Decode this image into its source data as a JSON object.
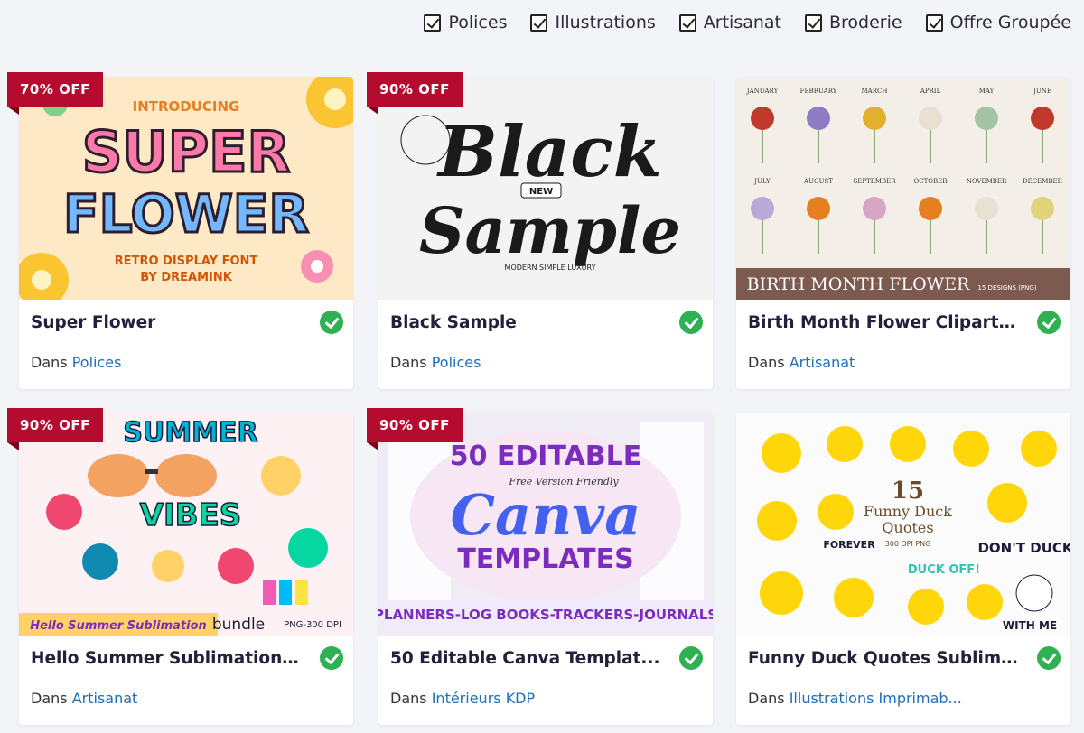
{
  "filters": [
    "Polices",
    "Illustrations",
    "Artisanat",
    "Broderie",
    "Offre Groupée"
  ],
  "category_prefix": "Dans",
  "cards": [
    {
      "badge": "70% OFF",
      "title": "Super Flower",
      "category": "Polices",
      "thumb": {
        "line1": "INTRODUCING",
        "big1": "SUPER",
        "big2": "FLOWER",
        "sub1": "RETRO DISPLAY FONT",
        "sub2": "BY DREAMINK"
      }
    },
    {
      "badge": "90% OFF",
      "title": "Black Sample",
      "category": "Polices",
      "thumb": {
        "big1": "Black",
        "big2": "Sample",
        "tag": "NEW",
        "sub": "MODERN SIMPLE LUXURY"
      }
    },
    {
      "badge": "",
      "title": "Birth Month Flower Clipart B...",
      "category": "Artisanat",
      "thumb": {
        "months_top": [
          "JANUARY",
          "FEBRUARY",
          "MARCH",
          "APRIL",
          "MAY",
          "JUNE"
        ],
        "months_bottom": [
          "JULY",
          "AUGUST",
          "SEPTEMBER",
          "OCTOBER",
          "NOVEMBER",
          "DECEMBER"
        ],
        "banner": "BIRTH MONTH FLOWER",
        "banner_sub": "15 DESIGNS (PNG)"
      }
    },
    {
      "badge": "90% OFF",
      "title": "Hello Summer Sublimation ...",
      "category": "Artisanat",
      "thumb": {
        "big": "SUMMER",
        "vibes": "VIBES",
        "footer": "Hello Summer Sublimation",
        "bundle": "bundle",
        "dpi": "PNG-300 DPI"
      }
    },
    {
      "badge": "90% OFF",
      "title": "50 Editable Canva Templat...",
      "category": "Intérieurs KDP",
      "thumb": {
        "line1": "50 EDITABLE",
        "script_small": "Free Version Friendly",
        "script": "Canva",
        "line2": "TEMPLATES",
        "footer": "PLANNERS-LOG BOOKS-TRACKERS-JOURNALS"
      }
    },
    {
      "badge": "",
      "title": "Funny Duck Quotes Sublim...",
      "category": "Illustrations Imprimab...",
      "thumb": {
        "num": "15",
        "l1": "Funny Duck",
        "l2": "Quotes",
        "l3": "300 DPI PNG",
        "q1": "DON'T DUCK",
        "q2": "WITH ME",
        "q3": "DUCK OFF!",
        "q4": "FOREVER"
      }
    }
  ],
  "colors": {
    "badge": "#b50b2e",
    "check": "#2fb052",
    "link": "#1e6fb8"
  }
}
